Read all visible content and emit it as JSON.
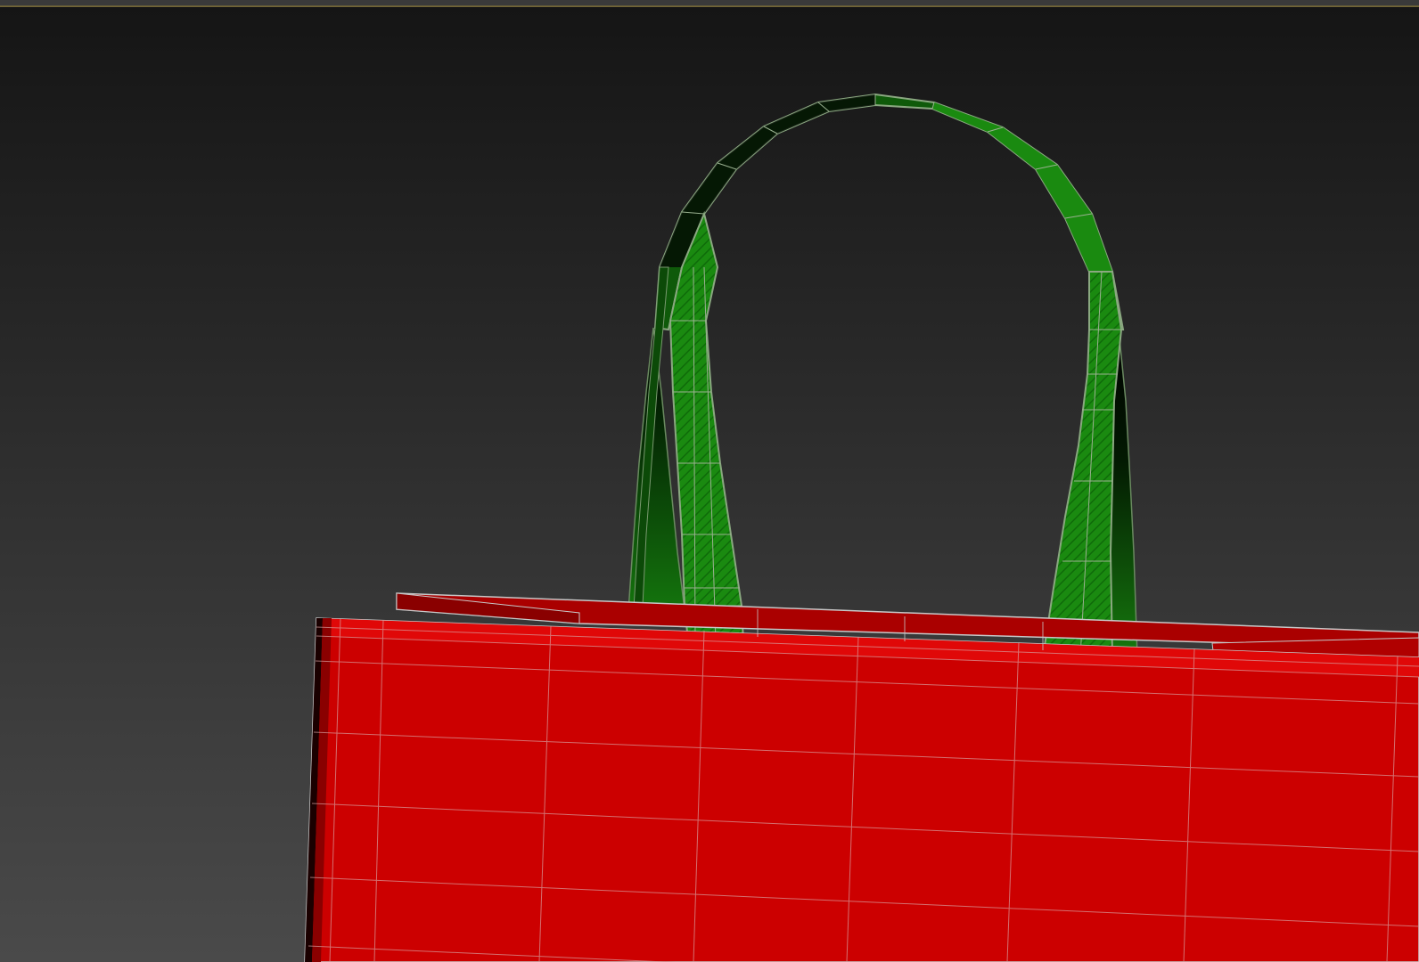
{
  "viewport": {
    "background_top": "#151515",
    "background_bottom": "#4a4a4a",
    "border_accent": "#8a7a3a"
  },
  "scene": {
    "bag_color": "#cc0000",
    "bag_highlight": "#e00808",
    "bag_shadow": "#8a0000",
    "handle_color": "#1a8a10",
    "handle_dark": "#0b3f08",
    "handle_edge": "#7a9a70",
    "wire_color": "#b4b4b4"
  }
}
